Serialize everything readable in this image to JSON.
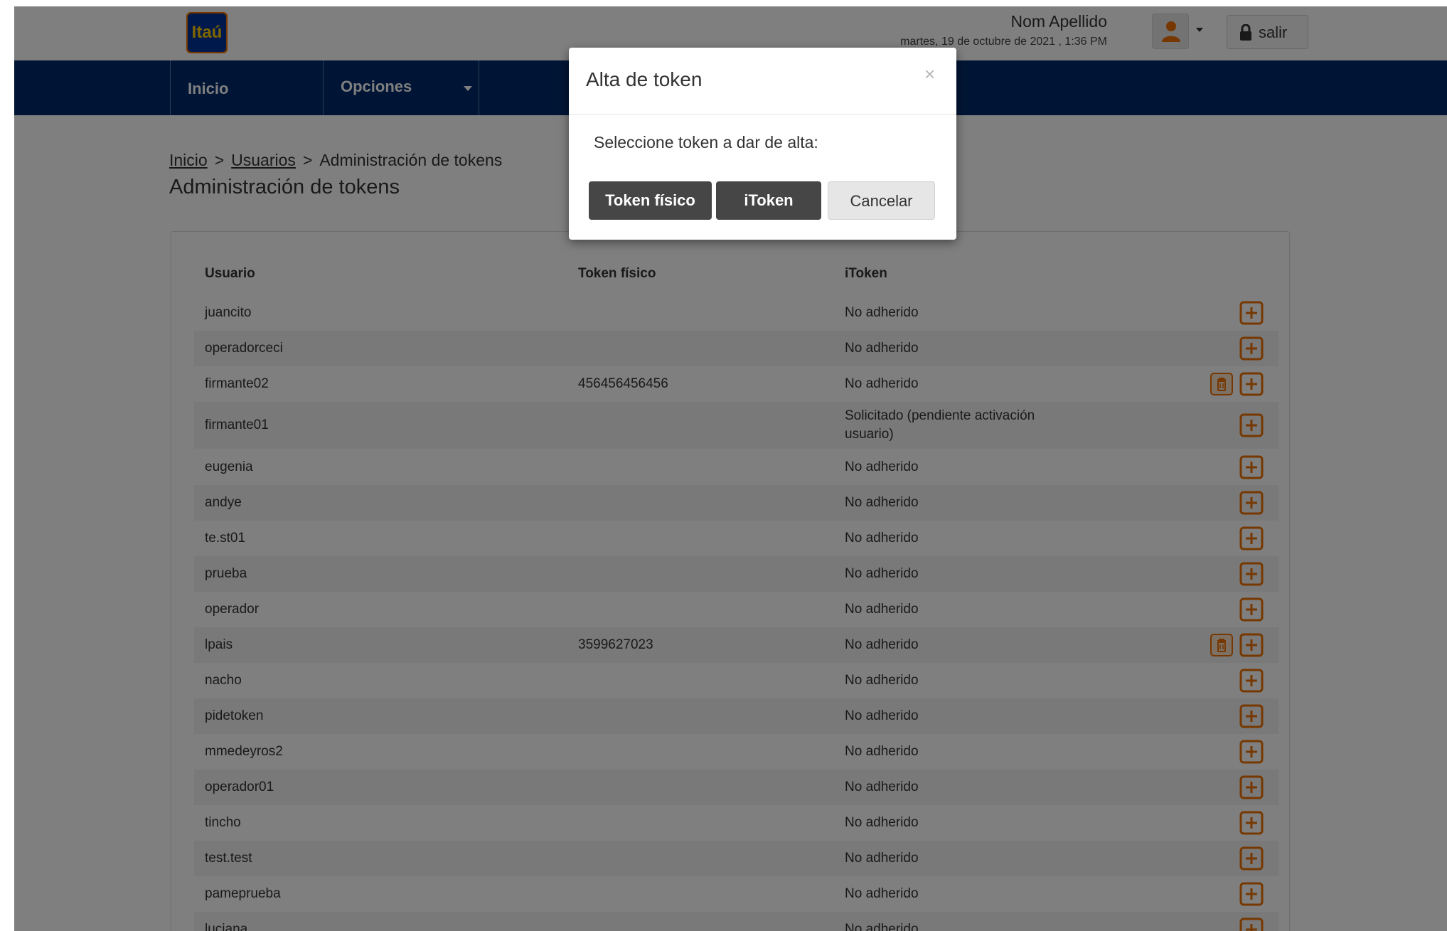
{
  "header": {
    "logo_text": "Itaú",
    "user_name": "Nom Apellido",
    "date_text": "martes, 19 de octubre de 2021 , 1:36 PM",
    "logout_label": "salir"
  },
  "nav": {
    "home_label": "Inicio",
    "options_label": "Opciones"
  },
  "breadcrumb": {
    "item1": "Inicio",
    "item2": "Usuarios",
    "current": "Administración de tokens",
    "separator": ">"
  },
  "page_title": "Administración de tokens",
  "table": {
    "headers": {
      "user": "Usuario",
      "physical": "Token físico",
      "itoken": "iToken"
    },
    "rows": [
      {
        "user": "juancito",
        "physical": "",
        "itoken": "No adherido",
        "has_delete": false
      },
      {
        "user": "operadorceci",
        "physical": "",
        "itoken": "No adherido",
        "has_delete": false
      },
      {
        "user": "firmante02",
        "physical": "456456456456",
        "itoken": "No adherido",
        "has_delete": true
      },
      {
        "user": "firmante01",
        "physical": "",
        "itoken": "Solicitado (pendiente activación",
        "itoken_line2": "usuario)",
        "has_delete": false
      },
      {
        "user": "eugenia",
        "physical": "",
        "itoken": "No adherido",
        "has_delete": false
      },
      {
        "user": "andye",
        "physical": "",
        "itoken": "No adherido",
        "has_delete": false
      },
      {
        "user": "te.st01",
        "physical": "",
        "itoken": "No adherido",
        "has_delete": false
      },
      {
        "user": "prueba",
        "physical": "",
        "itoken": "No adherido",
        "has_delete": false
      },
      {
        "user": "operador",
        "physical": "",
        "itoken": "No adherido",
        "has_delete": false
      },
      {
        "user": "lpais",
        "physical": "3599627023",
        "itoken": "No adherido",
        "has_delete": true
      },
      {
        "user": "nacho",
        "physical": "",
        "itoken": "No adherido",
        "has_delete": false
      },
      {
        "user": "pidetoken",
        "physical": "",
        "itoken": "No adherido",
        "has_delete": false
      },
      {
        "user": "mmedeyros2",
        "physical": "",
        "itoken": "No adherido",
        "has_delete": false
      },
      {
        "user": "operador01",
        "physical": "",
        "itoken": "No adherido",
        "has_delete": false
      },
      {
        "user": "tincho",
        "physical": "",
        "itoken": "No adherido",
        "has_delete": false
      },
      {
        "user": "test.test",
        "physical": "",
        "itoken": "No adherido",
        "has_delete": false
      },
      {
        "user": "pameprueba",
        "physical": "",
        "itoken": "No adherido",
        "has_delete": false
      },
      {
        "user": "luciana",
        "physical": "",
        "itoken": "No adherido",
        "has_delete": false
      }
    ]
  },
  "modal": {
    "title": "Alta de token",
    "close_symbol": "×",
    "message": "Seleccione token a dar de alta:",
    "btn_physical": "Token físico",
    "btn_itoken": "iToken",
    "btn_cancel": "Cancelar"
  },
  "icons": {
    "add": "add-square-icon",
    "delete": "trash-icon",
    "user": "user-icon",
    "lock": "lock-icon",
    "caret": "caret-down-icon"
  },
  "colors": {
    "nav_bg": "#002b6b",
    "accent_orange": "#ec7000",
    "overlay": "rgba(0,0,0,0.5)"
  }
}
